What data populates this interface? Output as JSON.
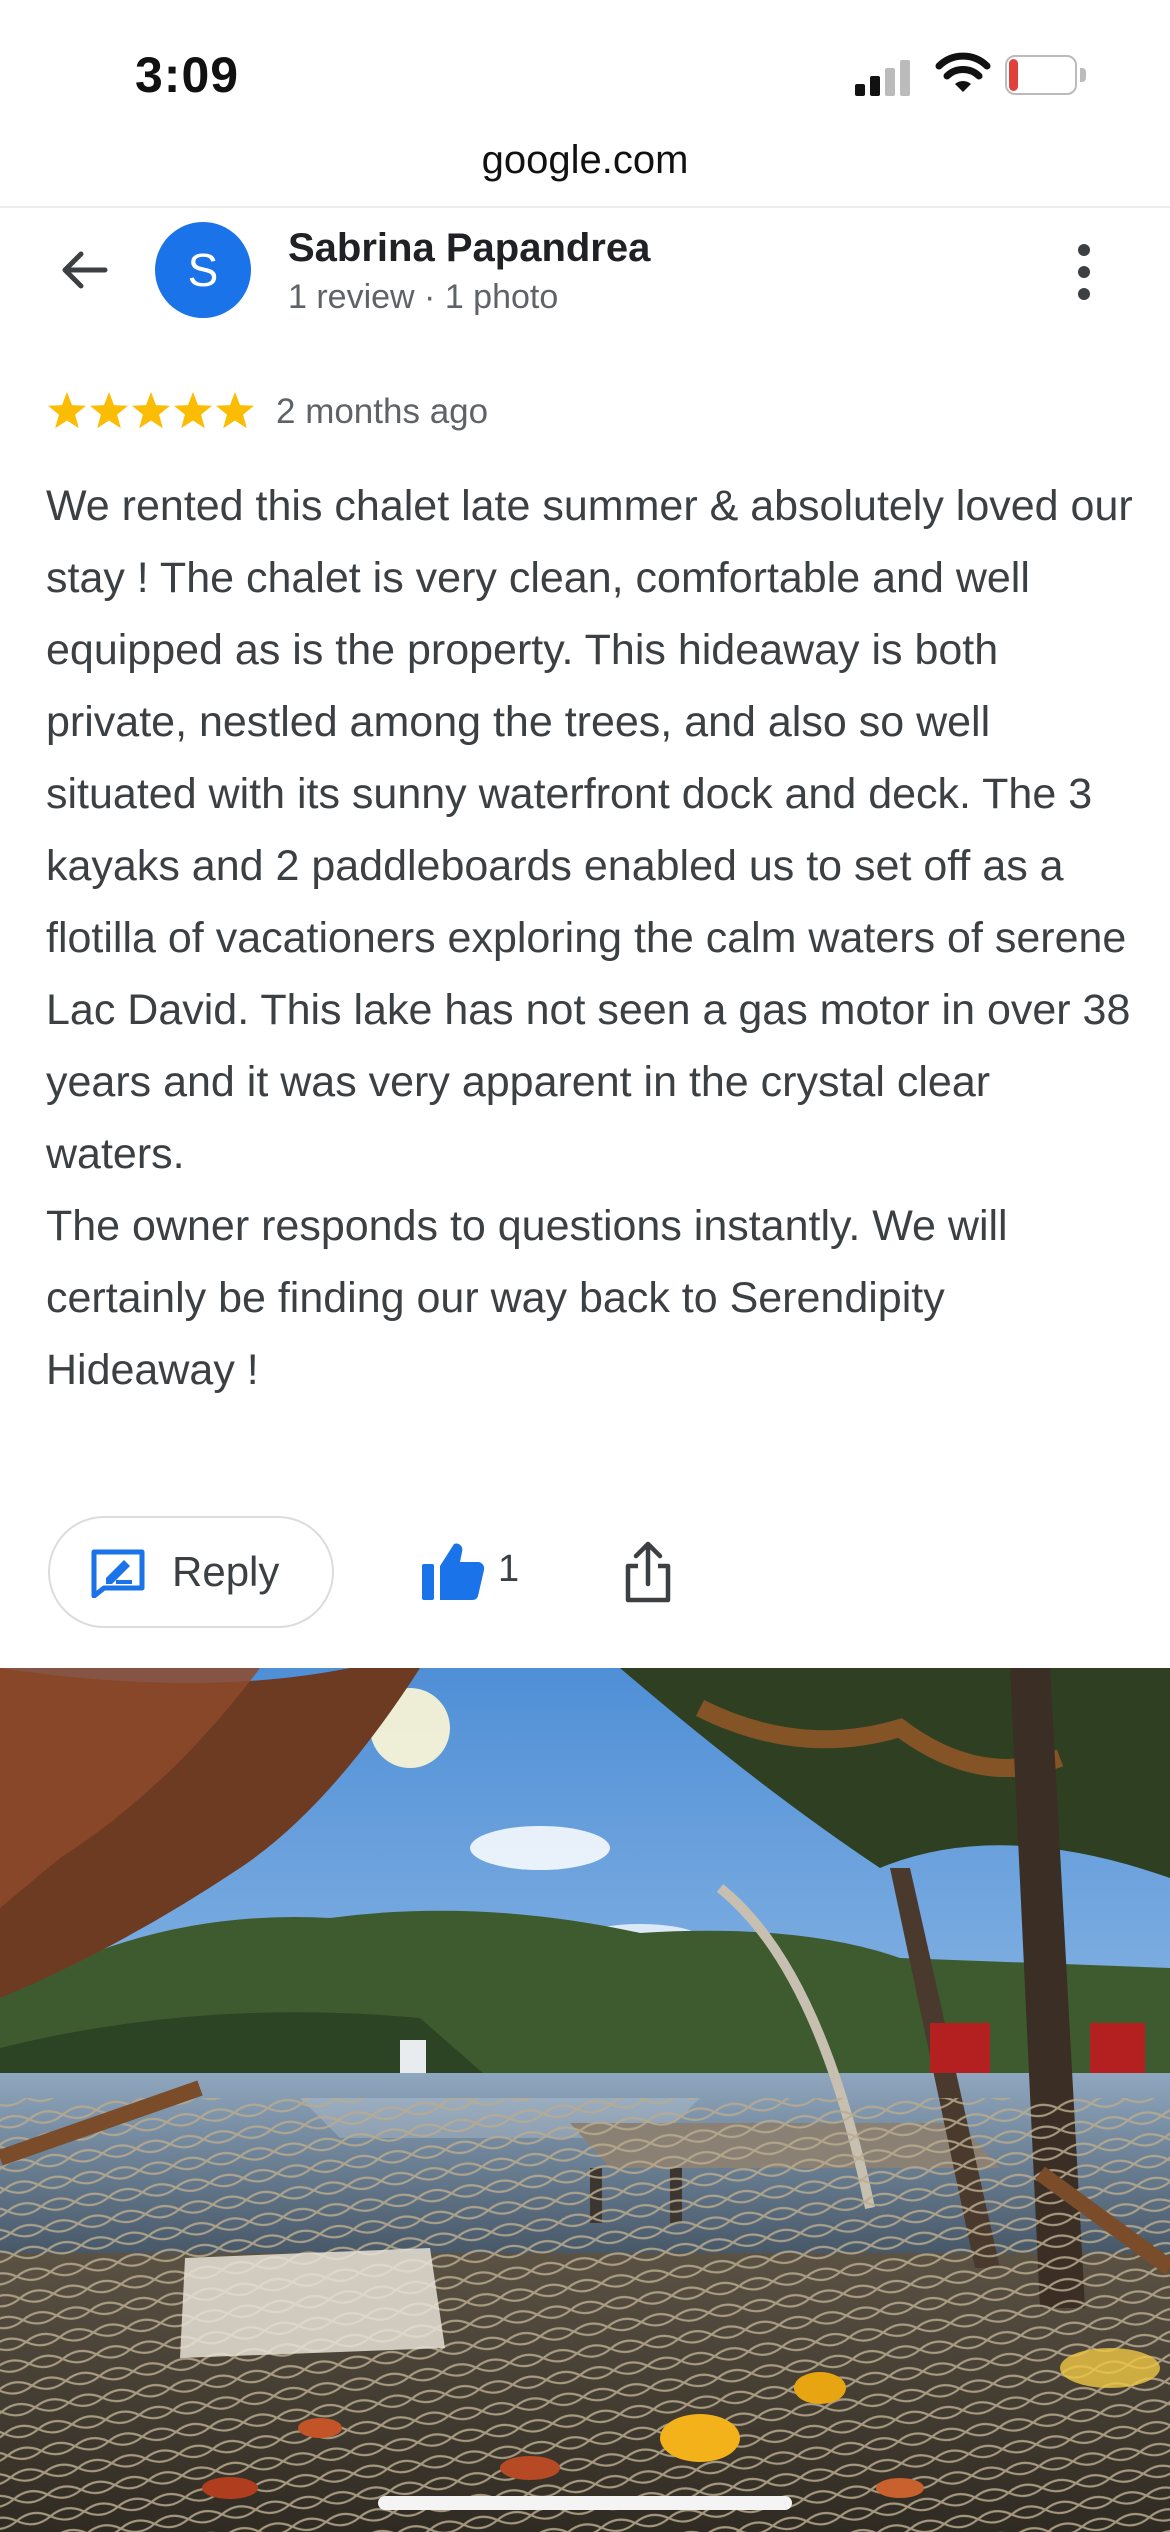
{
  "status_bar": {
    "time": "3:09",
    "battery_level": "13",
    "battery_fraction": 0.13
  },
  "browser": {
    "url": "google.com"
  },
  "reviewer": {
    "initial": "S",
    "name": "Sabrina Papandrea",
    "meta": "1 review · 1 photo",
    "avatar_color": "#1a73e8"
  },
  "review": {
    "stars": 5,
    "star_color": "#fbbc04",
    "date": "2 months ago",
    "paragraphs": [
      "We rented this chalet late summer & absolutely loved our stay ! The chalet is very clean, comfortable and well equipped as is the property. This hideaway is both private, nestled among the trees, and also so well situated with its sunny waterfront dock and deck. The 3 kayaks and 2 paddleboards enabled us to set off as a flotilla of vacationers exploring the calm  waters of serene Lac David. This lake has not seen a gas motor in over 38 years and it was very apparent in the crystal clear waters.",
      "The owner responds to questions instantly. We will certainly be finding our way back to Serendipity Hideaway !"
    ]
  },
  "actions": {
    "reply_label": "Reply",
    "like_count": "1",
    "accent_color": "#1a73e8"
  },
  "icons": {
    "back": "arrow-left-icon",
    "more": "more-vertical-icon",
    "reply": "reply-icon",
    "like": "thumbs-up-icon",
    "share": "share-icon",
    "signal": "signal-icon",
    "wifi": "wifi-icon"
  },
  "photo": {
    "alt": ""
  }
}
